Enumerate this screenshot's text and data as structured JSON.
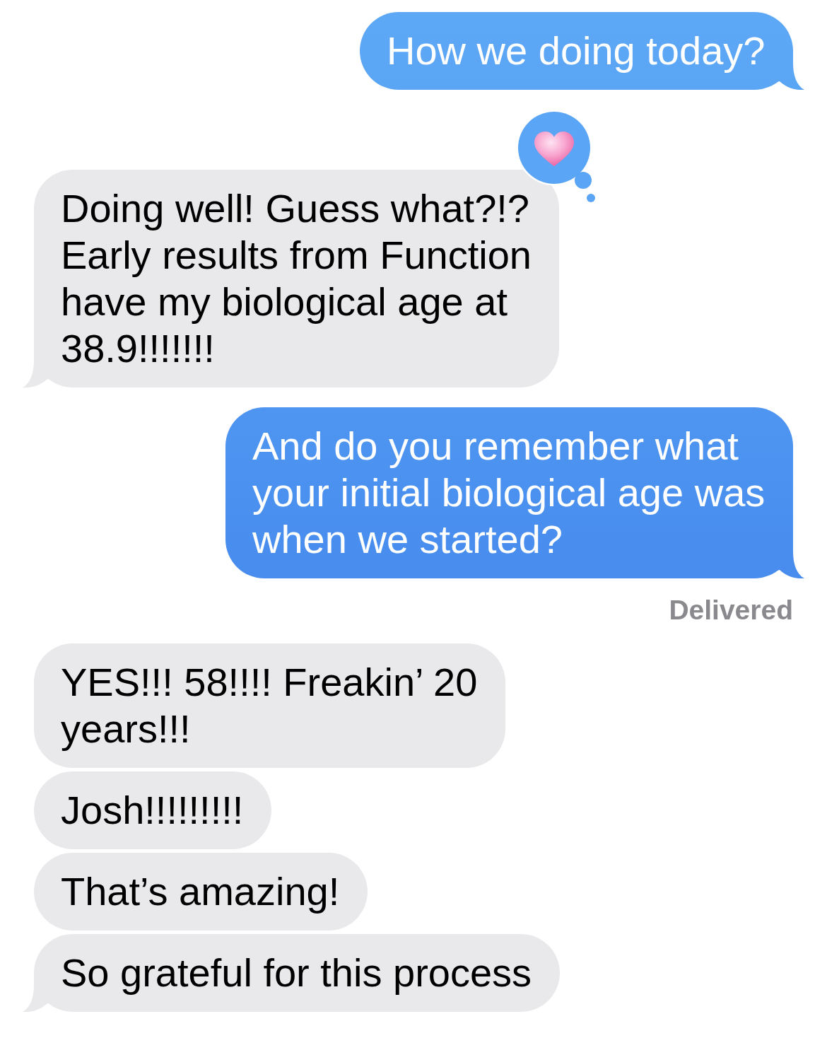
{
  "messages": [
    {
      "kind": "outgoing",
      "text": "How we doing today?",
      "tail": true,
      "hearted": false
    },
    {
      "kind": "incoming",
      "text": "Doing well! Guess what?!? Early results from Function have my biological age at 38.9!!!!!!!",
      "tail": true,
      "hearted": true
    },
    {
      "kind": "outgoing",
      "text": "And do you remember what your initial biological age was when we started?",
      "tail": true,
      "hearted": false,
      "status": "Delivered"
    },
    {
      "kind": "incoming",
      "text": "YES!!! 58!!!! Freakin’ 20 years!!!",
      "tail": false,
      "hearted": false
    },
    {
      "kind": "incoming",
      "text": "Josh!!!!!!!!!",
      "tail": false,
      "hearted": false
    },
    {
      "kind": "incoming",
      "text": "That’s amazing!",
      "tail": false,
      "hearted": false
    },
    {
      "kind": "incoming",
      "text": "So grateful for this process",
      "tail": true,
      "hearted": false
    }
  ]
}
